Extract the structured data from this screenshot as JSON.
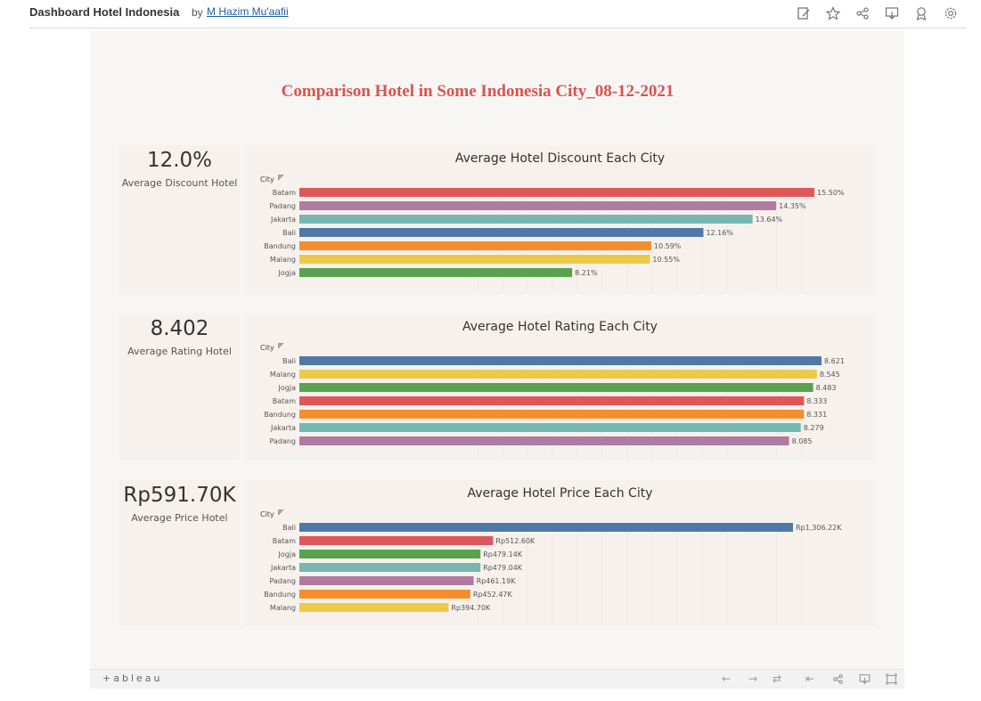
{
  "header": {
    "title": "Dashboard Hotel Indonesia",
    "by": "by",
    "author": "M Hazim Mu'aafii",
    "icons": [
      "edit-icon",
      "star-icon",
      "share-icon",
      "download-icon",
      "badge-icon",
      "settings-icon"
    ]
  },
  "dashboard": {
    "title": "Comparison Hotel in Some Indonesia City_08-12-2021",
    "kpis": [
      {
        "value": "12.0%",
        "label": "Average Discount Hotel"
      },
      {
        "value": "8.402",
        "label": "Average Rating Hotel"
      },
      {
        "value": "Rp591.70K",
        "label": "Average Price Hotel"
      }
    ]
  },
  "colors": {
    "Batam": "#e15759",
    "Padang": "#b07aa1",
    "Jakarta": "#76b7b2",
    "Bali": "#4e79a7",
    "Bandung": "#f28e2b",
    "Malang": "#edc948",
    "Jogja": "#59a14f",
    "title": "#d9534f"
  },
  "chart_data": [
    {
      "type": "bar",
      "orientation": "horizontal",
      "title": "Average Hotel Discount Each City",
      "ylabel": "City",
      "categories": [
        "Batam",
        "Padang",
        "Jakarta",
        "Bali",
        "Bandung",
        "Malang",
        "Jogja"
      ],
      "values": [
        15.5,
        14.35,
        13.64,
        12.16,
        10.59,
        10.55,
        8.21
      ],
      "labels": [
        "15.50%",
        "14.35%",
        "13.64%",
        "12.16%",
        "10.59%",
        "10.55%",
        "8.21%"
      ],
      "xlim": [
        0,
        15.5
      ]
    },
    {
      "type": "bar",
      "orientation": "horizontal",
      "title": "Average Hotel Rating Each City",
      "ylabel": "City",
      "categories": [
        "Bali",
        "Malang",
        "Jogja",
        "Batam",
        "Bandung",
        "Jakarta",
        "Padang"
      ],
      "values": [
        8.621,
        8.545,
        8.483,
        8.333,
        8.331,
        8.279,
        8.085
      ],
      "labels": [
        "8.621",
        "8.545",
        "8.483",
        "8.333",
        "8.331",
        "8.279",
        "8.085"
      ],
      "xlim": [
        0,
        8.621
      ]
    },
    {
      "type": "bar",
      "orientation": "horizontal",
      "title": "Average Hotel Price Each City",
      "ylabel": "City",
      "categories": [
        "Bali",
        "Batam",
        "Jogja",
        "Jakarta",
        "Padang",
        "Bandung",
        "Malang"
      ],
      "values": [
        1306.22,
        512.6,
        479.14,
        479.04,
        461.19,
        452.47,
        394.7
      ],
      "labels": [
        "Rp1,306.22K",
        "Rp512.60K",
        "Rp479.14K",
        "Rp479.04K",
        "Rp461.19K",
        "Rp452.47K",
        "Rp394.70K"
      ],
      "xlim": [
        0,
        1306.22
      ]
    }
  ],
  "footer": {
    "logo": "+ableau",
    "icons": [
      "undo-icon",
      "redo-icon",
      "revert-icon",
      "reset-icon",
      "share-icon",
      "download-icon",
      "fullscreen-icon"
    ]
  }
}
